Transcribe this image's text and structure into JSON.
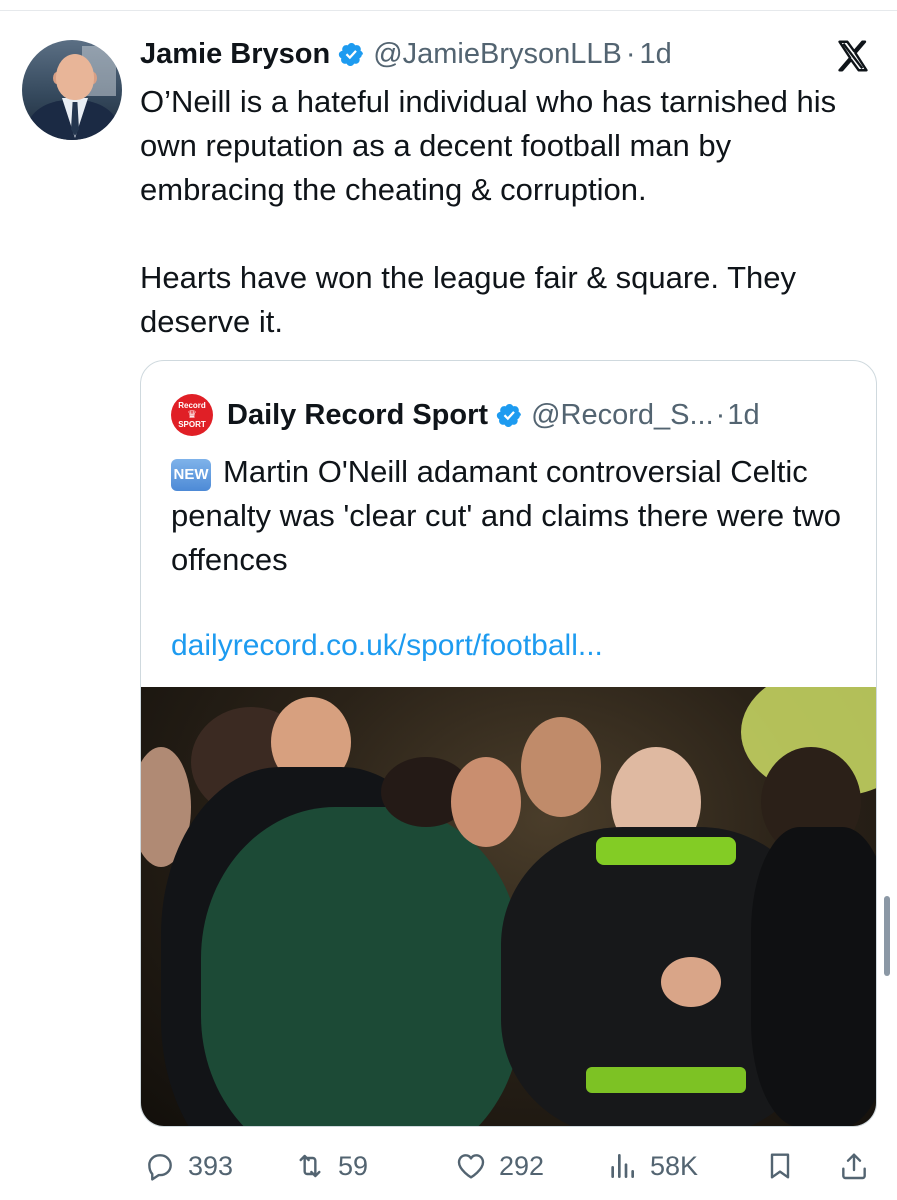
{
  "tweet": {
    "author_name": "Jamie Bryson",
    "handle": "@JamieBrysonLLB",
    "separator": "·",
    "time": "1d",
    "paragraphs": [
      "O’Neill is a hateful individual who has tarnished his own reputation as a decent football man by embracing the cheating & corruption.",
      "Hearts have won the league fair & square. They deserve it."
    ]
  },
  "quote": {
    "logo_top": "Record",
    "logo_bottom": "SPORT",
    "author_name": "Daily Record Sport",
    "handle": "@Record_S...",
    "separator": "·",
    "time": "1d",
    "badge": "NEW",
    "text": "Martin O'Neill adamant controversial Celtic penalty was 'clear cut' and claims there were two offences",
    "link": "dailyrecord.co.uk/sport/football..."
  },
  "actions": {
    "replies": "393",
    "reposts": "59",
    "likes": "292",
    "views": "58K"
  },
  "colors": {
    "text": "#0f1419",
    "secondary": "#536471",
    "link": "#1d9bf0",
    "verified": "#1d9bf0",
    "record_red": "#e01f26",
    "border": "#cfd9de"
  },
  "icons": {
    "verified": "verified-badge-icon",
    "x": "x-logo-icon",
    "reply": "reply-icon",
    "repost": "repost-icon",
    "like": "heart-icon",
    "views": "views-icon",
    "bookmark": "bookmark-icon",
    "share": "share-icon"
  }
}
